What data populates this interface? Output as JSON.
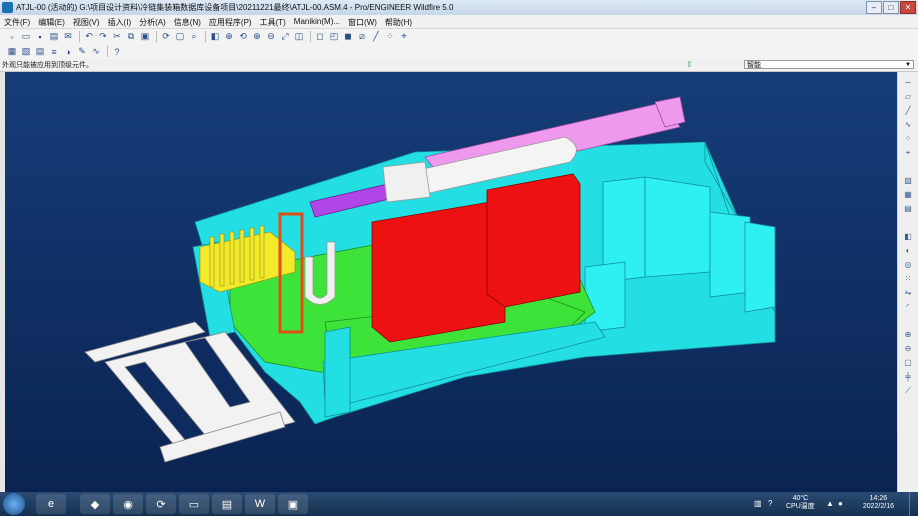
{
  "window": {
    "title": "ATJL-00 (活动的) G:\\项目设计资料\\冷链集装箱数据库设备项目\\20211221最终\\ATJL-00.ASM.4 - Pro/ENGINEER Wildfire 5.0",
    "minimize": "–",
    "maximize": "□",
    "close": "✕"
  },
  "menu": [
    "文件(F)",
    "编辑(E)",
    "视图(V)",
    "插入(I)",
    "分析(A)",
    "信息(N)",
    "应用程序(P)",
    "工具(T)",
    "Manikin(M)...",
    "窗口(W)",
    "帮助(H)"
  ],
  "status": {
    "message": "外观只能被应用到顶级元件。",
    "filter_value": "智能"
  },
  "taskbar": {
    "temp_value": "40°C",
    "temp_label": "CPU温度",
    "time": "14:26",
    "date": "2022/2/16",
    "apps": [
      "start",
      "ie",
      "chrome",
      "refresh",
      "explorer",
      "pdf",
      "word",
      "proe"
    ]
  },
  "colors": {
    "viewport_bg": "#0f2f66",
    "cyan": "#22e0e6",
    "green": "#3ee33a",
    "red": "#ee1111",
    "magenta": "#ee99ee",
    "purple": "#b046e6",
    "yellow": "#f2ea2a",
    "white": "#f2f2f2"
  }
}
